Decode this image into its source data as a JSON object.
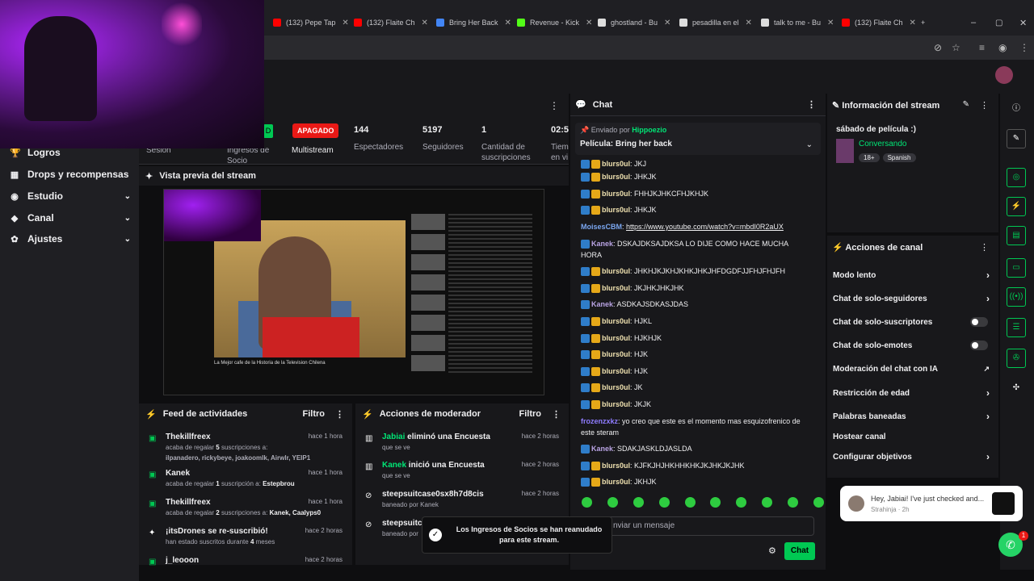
{
  "tabs": [
    {
      "label": "(132) Pepe Tap",
      "color": "#ff0000"
    },
    {
      "label": "(132) Flaite Ch",
      "color": "#ff0000"
    },
    {
      "label": "Bring Her Back",
      "color": "#4285f4"
    },
    {
      "label": "Revenue - Kick",
      "color": "#53fc18"
    },
    {
      "label": "ghostland - Bu",
      "color": "#dddddd"
    },
    {
      "label": "pesadilla en el",
      "color": "#dddddd"
    },
    {
      "label": "talk to me - Bu",
      "color": "#dddddd"
    },
    {
      "label": "(132) Flaite Ch",
      "color": "#ff0000"
    }
  ],
  "sidebar": {
    "items": [
      {
        "label": "Logros",
        "icon": "trophy-icon",
        "chev": ""
      },
      {
        "label": "Drops y recompensas",
        "icon": "gift-icon",
        "chev": ""
      },
      {
        "label": "Estudio",
        "icon": "studio-icon",
        "chev": "⌄"
      },
      {
        "label": "Canal",
        "icon": "channel-icon",
        "chev": "⌄"
      },
      {
        "label": "Ajustes",
        "icon": "gear-icon",
        "chev": "⌄"
      }
    ]
  },
  "stats": {
    "status": "APAGADO",
    "green_badge": "D",
    "sesion": "Sesión",
    "ingresos": "Ingresos de Socio",
    "multistream": "Multistream",
    "viewers": "144",
    "viewers_label": "Espectadores",
    "followers": "5197",
    "followers_label": "Seguidores",
    "subs": "1",
    "subs_label": "Cantidad de suscripciones",
    "time": "02:5",
    "time_label": "Tiem en vi"
  },
  "preview": {
    "title": "Vista previa del stream",
    "caption": "La Mejor cafe de la Historia de la Television Chilena"
  },
  "activity": {
    "title": "Feed de actividades",
    "filter": "Filtro",
    "items": [
      {
        "name": "Thekillfreex",
        "time": "hace 1 hora",
        "l1pre": "acaba de regalar ",
        "l1num": "5",
        "l1post": " suscripciones a:",
        "l2": "ilpanadero, rickybeye, joakoomlk, Airwlr, YEIP1"
      },
      {
        "name": "Kanek",
        "time": "hace 1 hora",
        "l1pre": "acaba de regalar ",
        "l1num": "1",
        "l1post": " suscripción a: ",
        "l2": "Estepbrou"
      },
      {
        "name": "Thekillfreex",
        "time": "hace 1 hora",
        "l1pre": "acaba de regalar ",
        "l1num": "2",
        "l1post": " suscripciones a: ",
        "l2": "Kanek, Caalyps0"
      },
      {
        "name": "¡itsDrones se re-suscribió!",
        "time": "hace 2 horas",
        "l1pre": "han estado suscritos durante ",
        "l1num": "4",
        "l1post": " meses",
        "l2": ""
      },
      {
        "name": "j_leooon",
        "time": "hace 2 horas",
        "l1pre": "",
        "l1num": "",
        "l1post": "",
        "l2": ""
      }
    ]
  },
  "mod": {
    "title": "Acciones de moderador",
    "filter": "Filtro",
    "items": [
      {
        "user": "Jabiai",
        "action": " eliminó una Encuesta",
        "sub": "que se ve",
        "time": "hace 2 horas"
      },
      {
        "user": "Kanek",
        "action": " inició una Encuesta",
        "sub": "que se ve",
        "time": "hace 2 horas"
      },
      {
        "user": "steepsuitcase0sx8h7d8cis",
        "action": "",
        "sub": "baneado por Kanek",
        "time": "hace 2 horas"
      },
      {
        "user": "steepsuitca",
        "action": "",
        "sub": "baneado por",
        "time": "hace 2 horas"
      }
    ]
  },
  "toast": {
    "text": "Los Ingresos de Socios se han reanudado para este stream."
  },
  "chat": {
    "title": "Chat",
    "pinned_by_label": "Enviado por",
    "pinned_user": "Hippoezio",
    "pinned_text": "Película: Bring her back",
    "messages": [
      {
        "user": "blurs0ul",
        "text": "JKJ",
        "cls": "u-blurs",
        "badges": "pc"
      },
      {
        "user": "blurs0ul",
        "text": "JHKJK",
        "cls": "u-blurs",
        "badges": "pc"
      },
      {
        "user": "blurs0ul",
        "text": "FHHJKJHKCFHJKHJK",
        "cls": "u-blurs",
        "badges": "pc"
      },
      {
        "user": "blurs0ul",
        "text": "JHKJK",
        "cls": "u-blurs",
        "badges": "pc"
      },
      {
        "user": "MoisesCBM",
        "text": "https://www.youtube.com/watch?v=mbdI0R2aUX",
        "cls": "u-moi",
        "badges": ""
      },
      {
        "user": "Kanek",
        "text": "DSKAJDKSAJDKSA LO DIJE COMO HACE MUCHA",
        "cls": "u-kanek",
        "badges": "p"
      },
      {
        "user": "",
        "text": "HORA",
        "cls": "",
        "badges": ""
      },
      {
        "user": "blurs0ul",
        "text": "JHKHJKJKHJKHKJHKJHFDGDFJJFHJFHJFH",
        "cls": "u-blurs",
        "badges": "pc"
      },
      {
        "user": "blurs0ul",
        "text": "JKJHKJHKJHK",
        "cls": "u-blurs",
        "badges": "pc"
      },
      {
        "user": "Kanek",
        "text": "ASDKAJSDKASJDAS",
        "cls": "u-kanek",
        "badges": "p"
      },
      {
        "user": "blurs0ul",
        "text": "HJKL",
        "cls": "u-blurs",
        "badges": "pc"
      },
      {
        "user": "blurs0ul",
        "text": "HJKHJK",
        "cls": "u-blurs",
        "badges": "pc"
      },
      {
        "user": "blurs0ul",
        "text": "HJK",
        "cls": "u-blurs",
        "badges": "pc"
      },
      {
        "user": "blurs0ul",
        "text": "HJK",
        "cls": "u-blurs",
        "badges": "pc"
      },
      {
        "user": "blurs0ul",
        "text": "JK",
        "cls": "u-blurs",
        "badges": "pc"
      },
      {
        "user": "blurs0ul",
        "text": "JKJK",
        "cls": "u-blurs",
        "badges": "pc"
      },
      {
        "user": "frozenzxkz",
        "text": "yo creo que este es el momento mas esquizofrenico de",
        "cls": "u-frozen",
        "badges": ""
      },
      {
        "user": "",
        "text": "este steram",
        "cls": "",
        "badges": ""
      },
      {
        "user": "Kanek",
        "text": "SDAKJASKLDJASLDA",
        "cls": "u-kanek",
        "badges": "p"
      },
      {
        "user": "blurs0ul",
        "text": "KJFKJHJHKHHKHKJKJHKJKJHK",
        "cls": "u-blurs",
        "badges": "pc"
      },
      {
        "user": "blurs0ul",
        "text": "JKHJK",
        "cls": "u-blurs",
        "badges": "pc"
      }
    ],
    "input_placeholder": "nviar un mensaje",
    "send_label": "Chat"
  },
  "info": {
    "title": "Información del stream",
    "stream_title": "sábado de película :)",
    "category": "Conversando",
    "tags": [
      "18+",
      "Spanish"
    ]
  },
  "channel_actions": {
    "title": "Acciones de canal",
    "items": [
      {
        "label": "Modo lento",
        "ctrl": "chev"
      },
      {
        "label": "Chat de solo-seguidores",
        "ctrl": "chev"
      },
      {
        "label": "Chat de solo-suscriptores",
        "ctrl": "toggle"
      },
      {
        "label": "Chat de solo-emotes",
        "ctrl": "toggle"
      },
      {
        "label": "Moderación del chat con IA",
        "ctrl": "ext"
      },
      {
        "label": "Restricción de edad",
        "ctrl": "chev"
      },
      {
        "label": "Palabras baneadas",
        "ctrl": "chev"
      },
      {
        "label": "Hostear canal",
        "ctrl": ""
      },
      {
        "label": "Configurar objetivos",
        "ctrl": "chev"
      }
    ]
  },
  "notification": {
    "text": "Hey, Jabiai! I've just checked and...",
    "sender": "Strahinja · 2h",
    "badge": "1"
  },
  "colors": {
    "accent": "#00c853",
    "live_off": "#e91916"
  }
}
